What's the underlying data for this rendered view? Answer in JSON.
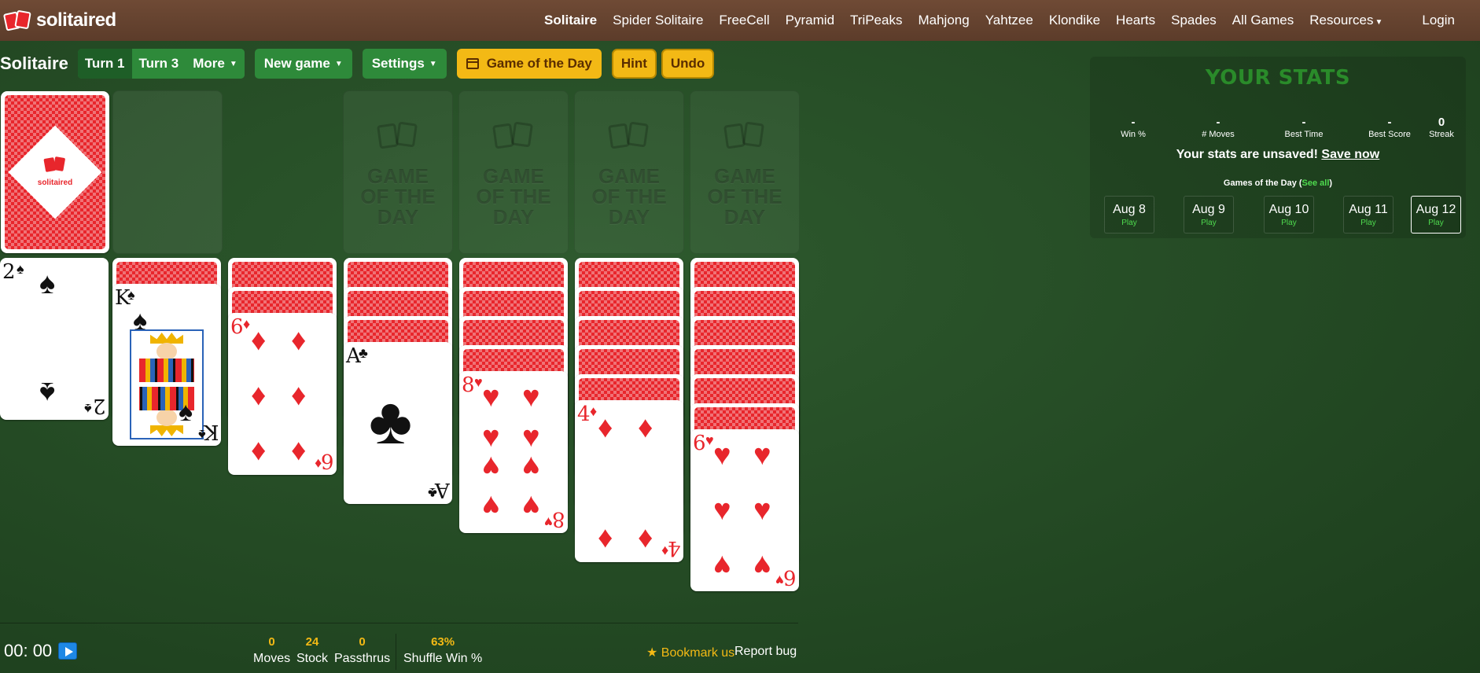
{
  "brand": {
    "name": "solitaired"
  },
  "nav": {
    "links": [
      "Solitaire",
      "Spider Solitaire",
      "FreeCell",
      "Pyramid",
      "TriPeaks",
      "Mahjong",
      "Yahtzee",
      "Klondike",
      "Hearts",
      "Spades",
      "All Games",
      "Resources"
    ],
    "login": "Login"
  },
  "toolbar": {
    "title": "Solitaire",
    "turn1": "Turn 1",
    "turn3": "Turn 3",
    "more": "More",
    "new_game": "New game",
    "settings": "Settings",
    "game_of_day": "Game of the Day",
    "hint": "Hint",
    "undo": "Undo"
  },
  "board": {
    "stock_logo_text": "solitaired",
    "foundation_placeholder": "GAME OF THE DAY",
    "foundation_line1": "GAME",
    "foundation_line2": "OF THE",
    "foundation_line3": "DAY",
    "tableau": [
      {
        "face_down": 0,
        "rank": "2",
        "suit": "♠",
        "color": "black"
      },
      {
        "face_down": 1,
        "rank": "K",
        "suit": "♠",
        "color": "black"
      },
      {
        "face_down": 2,
        "rank": "6",
        "suit": "♦",
        "color": "red"
      },
      {
        "face_down": 3,
        "rank": "A",
        "suit": "♣",
        "color": "black"
      },
      {
        "face_down": 4,
        "rank": "8",
        "suit": "♥",
        "color": "red"
      },
      {
        "face_down": 5,
        "rank": "4",
        "suit": "♦",
        "color": "red"
      },
      {
        "face_down": 6,
        "rank": "6",
        "suit": "♥",
        "color": "red"
      }
    ]
  },
  "stats": {
    "title": "YOUR STATS",
    "items": [
      {
        "value": "-",
        "label": "Win %"
      },
      {
        "value": "-",
        "label": "# Moves"
      },
      {
        "value": "-",
        "label": "Best Time"
      },
      {
        "value": "-",
        "label": "Best Score"
      },
      {
        "value": "0",
        "label": "Streak"
      }
    ],
    "unsaved_text": "Your stats are unsaved!",
    "save_now": "Save now",
    "gotd_label": "Games of the Day (",
    "see_all": "See all",
    "gotd_close": ")",
    "days": [
      {
        "date": "Aug 8",
        "action": "Play"
      },
      {
        "date": "Aug 9",
        "action": "Play"
      },
      {
        "date": "Aug 10",
        "action": "Play"
      },
      {
        "date": "Aug 11",
        "action": "Play"
      },
      {
        "date": "Aug 12",
        "action": "Play"
      }
    ]
  },
  "footer": {
    "timer": "00: 00",
    "moves": {
      "value": "0",
      "label": "Moves"
    },
    "stock": {
      "value": "24",
      "label": "Stock"
    },
    "passthrus": {
      "value": "0",
      "label": "Passthrus"
    },
    "shuffle": {
      "value": "63%",
      "label": "Shuffle Win %"
    },
    "bookmark": "★ Bookmark us",
    "report": "Report bug"
  },
  "colors": {
    "felt": "#244a24",
    "nav": "#5c3c2a",
    "green_btn": "#2e8a3a",
    "yellow_btn": "#f3b915",
    "card_red": "#e8262c"
  }
}
